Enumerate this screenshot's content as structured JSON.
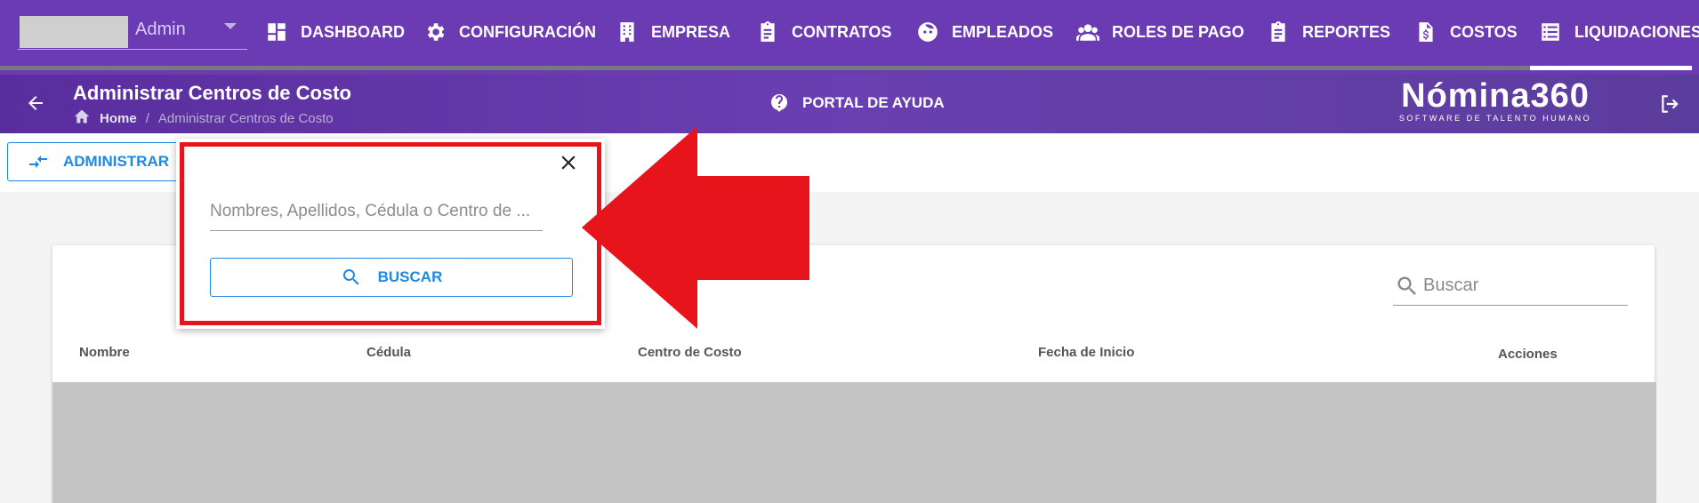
{
  "topnav": {
    "user": {
      "name": "Admin"
    },
    "items": [
      {
        "label": "DASHBOARD",
        "icon": "dashboard-icon"
      },
      {
        "label": "CONFIGURACIÓN",
        "icon": "gear-icon"
      },
      {
        "label": "EMPRESA",
        "icon": "building-icon"
      },
      {
        "label": "CONTRATOS",
        "icon": "clipboard-icon"
      },
      {
        "label": "EMPLEADOS",
        "icon": "face-icon"
      },
      {
        "label": "ROLES DE PAGO",
        "icon": "people-icon"
      },
      {
        "label": "REPORTES",
        "icon": "clipboard-icon"
      },
      {
        "label": "COSTOS",
        "icon": "dollar-file-icon"
      },
      {
        "label": "LIQUIDACIONES",
        "icon": "list-icon"
      }
    ]
  },
  "header": {
    "title": "Administrar Centros de Costo",
    "breadcrumb": {
      "home": "Home",
      "separator": "/",
      "current": "Administrar Centros de Costo"
    },
    "help_label": "PORTAL DE AYUDA",
    "brand": {
      "name": "Nómina360",
      "tagline": "SOFTWARE DE TALENTO HUMANO"
    }
  },
  "toolbar": {
    "admin_label": "ADMINISTRAR"
  },
  "table": {
    "search_placeholder": "Buscar",
    "columns": [
      "Nombre",
      "Cédula",
      "Centro de Costo",
      "Fecha de Inicio",
      "Acciones"
    ]
  },
  "popup": {
    "search_placeholder": "Nombres, Apellidos, Cédula o Centro de ...",
    "search_button": "BUSCAR"
  },
  "colors": {
    "primary_purple": "#6a3bb3",
    "accent_blue": "#1e88e5",
    "annotation_red": "#e8141c"
  }
}
